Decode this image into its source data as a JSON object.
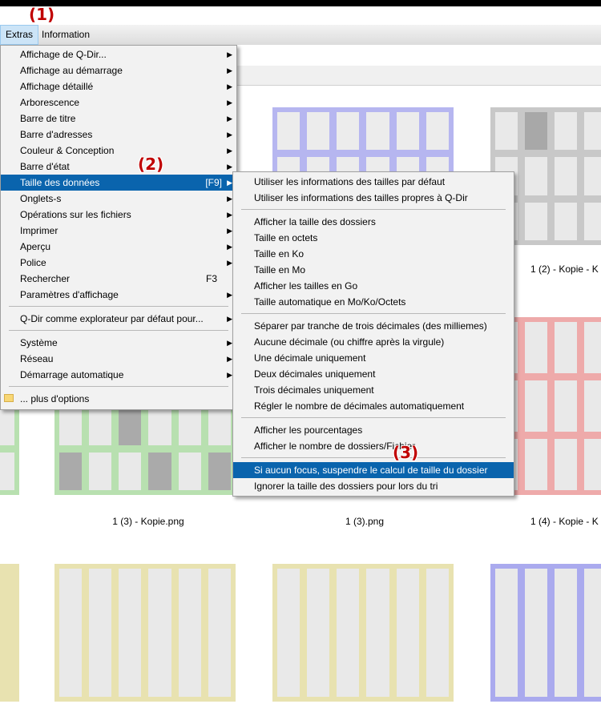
{
  "menubar": {
    "extras": "Extras",
    "information": "Information"
  },
  "callouts": [
    "(1)",
    "(2)",
    "(3)"
  ],
  "main_menu": [
    {
      "label": "Affichage de Q-Dir...",
      "submenu": true
    },
    {
      "label": "Affichage au démarrage",
      "submenu": true
    },
    {
      "label": "Affichage détaillé",
      "submenu": true
    },
    {
      "label": "Arborescence",
      "submenu": true
    },
    {
      "label": "Barre de titre",
      "submenu": true
    },
    {
      "label": "Barre d'adresses",
      "submenu": true
    },
    {
      "label": "Couleur & Conception",
      "submenu": true
    },
    {
      "label": "Barre d'état",
      "submenu": true
    },
    {
      "label": "Taille des données",
      "shortcut": "[F9]",
      "submenu": true
    },
    {
      "label": "Onglets-s",
      "submenu": true
    },
    {
      "label": "Opérations sur les fichiers",
      "submenu": true
    },
    {
      "label": "Imprimer",
      "submenu": true
    },
    {
      "label": "Aperçu",
      "submenu": true
    },
    {
      "label": "Police",
      "submenu": true
    },
    {
      "label": "Rechercher",
      "shortcut": "F3"
    },
    {
      "label": "Paramètres d'affichage",
      "submenu": true
    },
    {
      "label": "Q-Dir comme explorateur par défaut pour...",
      "submenu": true
    },
    {
      "label": "Système",
      "submenu": true
    },
    {
      "label": "Réseau",
      "submenu": true
    },
    {
      "label": "Démarrage automatique",
      "submenu": true
    },
    {
      "label": "... plus d'options"
    }
  ],
  "sub_menu": [
    "Utiliser les informations des tailles par défaut",
    "Utiliser les informations des tailles propres à Q-Dir",
    "Afficher la taille des dossiers",
    "Taille en octets",
    "Taille en Ko",
    "Taille en Mo",
    "Afficher les tailles en Go",
    "Taille automatique en Mo/Ko/Octets",
    "Séparer par tranche de trois décimales (des milliemes)",
    "Aucune décimale (ou chiffre après la virgule)",
    "Une décimale uniquement",
    "Deux décimales uniquement",
    "Trois décimales uniquement",
    "Régler le nombre de décimales automatiquement",
    "Afficher les pourcentages",
    "Afficher le nombre de dossiers/Fichier",
    "Si aucun focus, suspendre le calcul de taille du dossier",
    "Ignorer la taille des dossiers pour lors du tri"
  ],
  "captions": [
    "1 (2) - Kopie - K",
    "1 (3) - Kopie.png",
    "1 (3).png",
    "1 (4) - Kopie - K"
  ],
  "colors": {
    "highlight": "#0a64ad",
    "thumb_blue": "#aaaaee",
    "thumb_gray": "#c8c8c8",
    "thumb_red": "#eeaaaa",
    "thumb_green": "#b8e0b0",
    "thumb_yellow": "#e8e2b0",
    "callout": "#c00000"
  }
}
